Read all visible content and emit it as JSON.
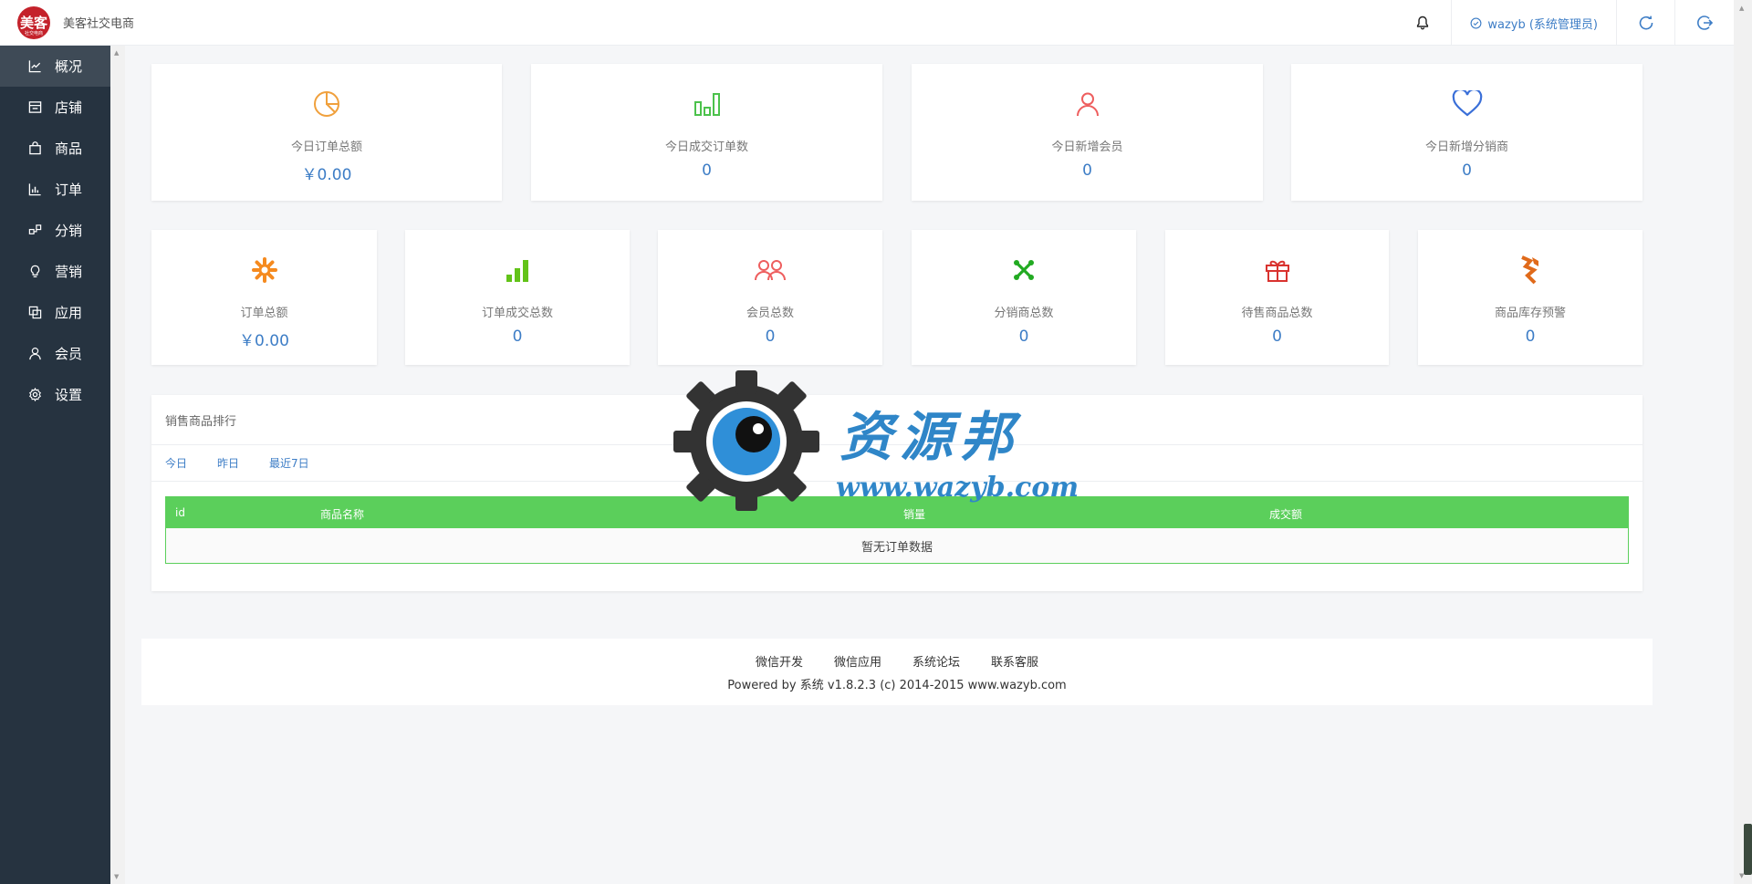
{
  "header": {
    "logo_text": "美客",
    "logo_sub": "社交电商",
    "brand": "美客社交电商",
    "user": "wazyb (系统管理员)"
  },
  "sidebar": {
    "items": [
      {
        "label": "概况",
        "icon": "chart-line-icon",
        "active": true
      },
      {
        "label": "店铺",
        "icon": "store-icon"
      },
      {
        "label": "商品",
        "icon": "shopping-bag-icon"
      },
      {
        "label": "订单",
        "icon": "bar-chart-icon"
      },
      {
        "label": "分销",
        "icon": "network-icon"
      },
      {
        "label": "营销",
        "icon": "lightbulb-icon"
      },
      {
        "label": "应用",
        "icon": "copy-icon"
      },
      {
        "label": "会员",
        "icon": "user-icon"
      },
      {
        "label": "设置",
        "icon": "gear-icon"
      }
    ]
  },
  "stats_top": [
    {
      "label": "今日订单总额",
      "value": "￥0.00",
      "icon": "pie-chart-icon",
      "color": "#f0a03c"
    },
    {
      "label": "今日成交订单数",
      "value": "0",
      "icon": "bar-chart-icon",
      "color": "#4cc24c"
    },
    {
      "label": "今日新增会员",
      "value": "0",
      "icon": "user-icon",
      "color": "#ee5e5e"
    },
    {
      "label": "今日新增分销商",
      "value": "0",
      "icon": "heart-icon",
      "color": "#3a6fd8"
    }
  ],
  "stats_bottom": [
    {
      "label": "订单总额",
      "value": "￥0.00",
      "icon": "gear-icon",
      "color": "#f58a1f"
    },
    {
      "label": "订单成交总数",
      "value": "0",
      "icon": "signal-bars-icon",
      "color": "#62c318"
    },
    {
      "label": "会员总数",
      "value": "0",
      "icon": "users-icon",
      "color": "#ee5e5e"
    },
    {
      "label": "分销商总数",
      "value": "0",
      "icon": "joomla-icon",
      "color": "#22aa22"
    },
    {
      "label": "待售商品总数",
      "value": "0",
      "icon": "gift-icon",
      "color": "#d9332f"
    },
    {
      "label": "商品库存预警",
      "value": "0",
      "icon": "hubspot-icon",
      "color": "#e06a1a"
    }
  ],
  "ranking": {
    "title": "销售商品排行",
    "tabs": [
      "今日",
      "昨日",
      "最近7日"
    ],
    "columns": [
      "id",
      "商品名称",
      "销量",
      "成交额"
    ],
    "empty_text": "暂无订单数据"
  },
  "footer": {
    "links": [
      "微信开发",
      "微信应用",
      "系统论坛",
      "联系客服"
    ],
    "copyright": "Powered by 系统 v1.8.2.3 (c) 2014-2015 www.wazyb.com"
  },
  "watermark": {
    "title": "资源邦",
    "url": "www.wazyb.com"
  }
}
